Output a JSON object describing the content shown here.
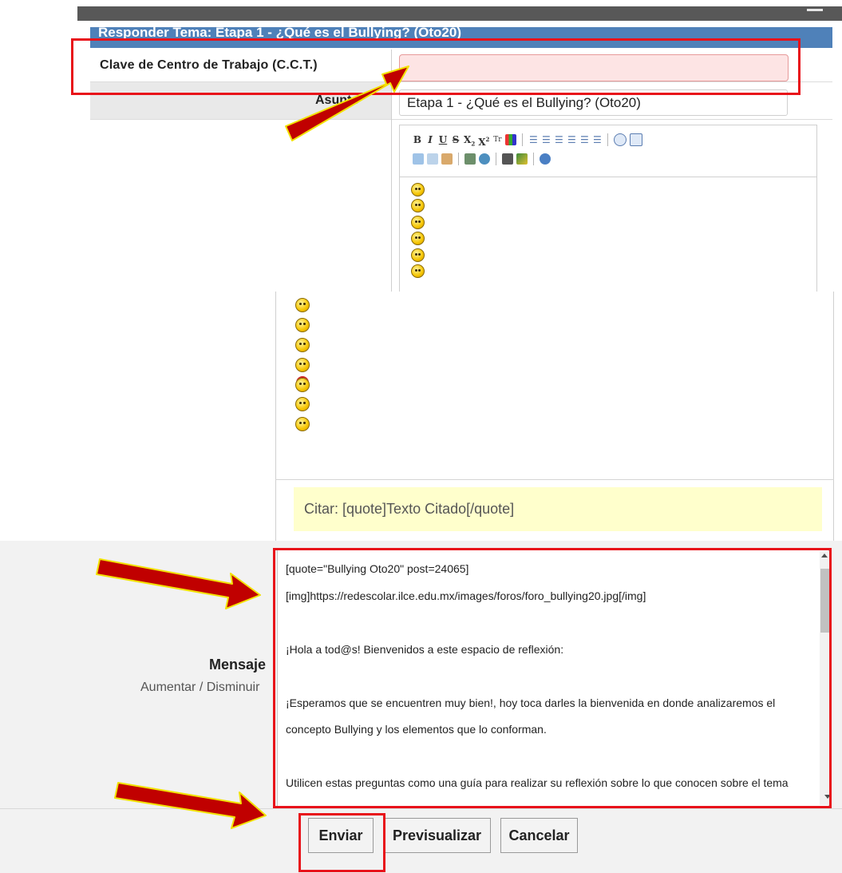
{
  "form": {
    "header_title": "Responder Tema: Etapa 1 - ¿Qué es el Bullying? (Oto20)",
    "cct_label": "Clave de Centro de Trabajo (C.C.T.)",
    "cct_value": "",
    "asunto_label": "Asunto",
    "asunto_value": "Etapa 1 - ¿Qué es el Bullying? (Oto20)"
  },
  "toolbar": {
    "row1": [
      "B",
      "I",
      "U",
      "S",
      "X₂",
      "X²",
      "Tr",
      "color-grid",
      "|",
      "bullet-list",
      "numbered-list",
      "align-left",
      "align-center",
      "align-right",
      "align-justify",
      "|",
      "speech-bubble",
      "source-code"
    ],
    "row2": [
      "table",
      "comment",
      "users",
      "|",
      "image",
      "world",
      "|",
      "film",
      "map",
      "|",
      "help"
    ]
  },
  "quote_hint": "Citar: [quote]Texto Citado[/quote]",
  "message": {
    "label": "Mensaje",
    "increase_link": "Aumentar /",
    "decrease_link": "Disminuir",
    "text": "[quote=\"Bullying Oto20\" post=24065]\n[img]https://redescolar.ilce.edu.mx/images/foros/foro_bullying20.jpg[/img]\n\n¡Hola a tod@s! Bienvenidos a este espacio de reflexión:\n\n¡Esperamos que se encuentren muy bien!, hoy toca darles la bienvenida en donde analizaremos el\nconcepto Bullying y los elementos que lo conforman.\n\nUtilicen estas preguntas como una guía para realizar su reflexión sobre lo que conocen sobre el tema\nbullying:"
  },
  "buttons": {
    "send": "Enviar",
    "preview": "Previsualizar",
    "cancel": "Cancelar"
  },
  "colors": {
    "header_blue": "#4f81b9",
    "annotation_red": "#e8121a",
    "arrow_fill": "#c00000",
    "arrow_outline": "#f2e200",
    "required_field_pink": "#fde4e4"
  }
}
